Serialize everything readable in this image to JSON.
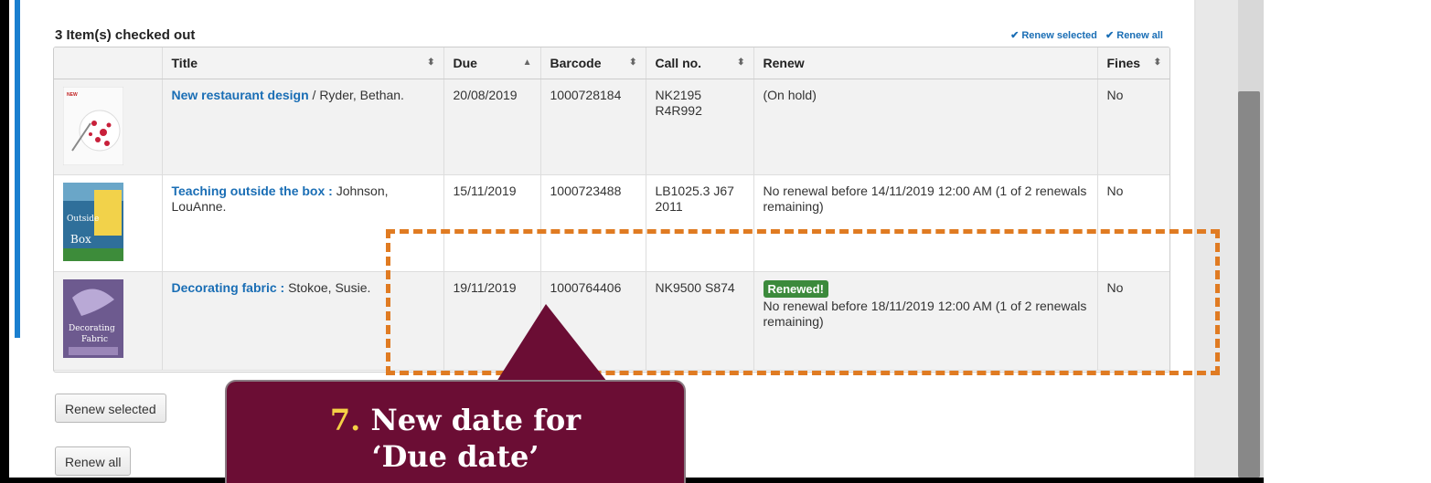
{
  "checkout": {
    "heading": "3 Item(s) checked out",
    "renew_selected_link": "Renew selected",
    "renew_all_link": "Renew all",
    "columns": [
      "Title",
      "Due",
      "Barcode",
      "Call no.",
      "Renew",
      "Fines"
    ],
    "rows": [
      {
        "title": "New restaurant design",
        "author": " / Ryder, Bethan.",
        "due": "20/08/2019",
        "barcode": "1000728184",
        "callno": "NK2195 R4R992",
        "renew_text": "(On hold)",
        "fines": "No"
      },
      {
        "title": "Teaching outside the box :",
        "author": " Johnson, LouAnne.",
        "due": "15/11/2019",
        "barcode": "1000723488",
        "callno": "LB1025.3 J67 2011",
        "renew_text": "No renewal before 14/11/2019 12:00 AM (1 of 2 renewals remaining)",
        "fines": "No"
      },
      {
        "title": "Decorating fabric :",
        "author": " Stokoe, Susie.",
        "due": "19/11/2019",
        "barcode": "1000764406",
        "callno": "NK9500 S874",
        "badge": "Renewed!",
        "renew_text": "No renewal before 18/11/2019 12:00 AM (1 of 2 renewals remaining)",
        "fines": "No"
      }
    ],
    "renew_selected_button": "Renew selected",
    "renew_all_button": "Renew all"
  },
  "callout": {
    "number": "7.",
    "text": " New date for",
    "line2": "‘Due date’"
  },
  "colors": {
    "link": "#1a6eb5",
    "badge": "#3c8a3c",
    "callout_bg": "#6b0d34",
    "callout_dash": "#e07b22",
    "callout_number": "#f4d046"
  }
}
